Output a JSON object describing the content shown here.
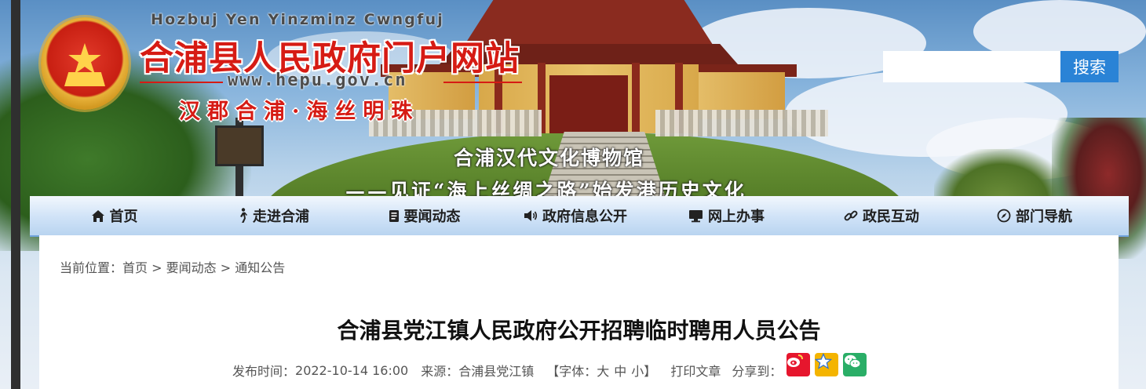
{
  "header": {
    "pinyin": "Hozbuj Yen Yinzminz Cwngfuj",
    "site_title": "合浦县人民政府门户网站",
    "site_url": "www.hepu.gov.cn",
    "slogan": "汉郡合浦·海丝明珠",
    "banner_caption": "合浦汉代文化博物馆",
    "banner_subcaption": "——见证“海上丝绸之路”始发港历史文化"
  },
  "search": {
    "placeholder": "",
    "button_label": "搜索",
    "accent_color": "#2a83d6"
  },
  "nav": {
    "items": [
      {
        "label": "首页",
        "icon": "home-icon"
      },
      {
        "label": "走进合浦",
        "icon": "walking-person-icon"
      },
      {
        "label": "要闻动态",
        "icon": "document-icon"
      },
      {
        "label": "政府信息公开",
        "icon": "speaker-icon"
      },
      {
        "label": "网上办事",
        "icon": "monitor-icon"
      },
      {
        "label": "政民互动",
        "icon": "link-icon"
      },
      {
        "label": "部门导航",
        "icon": "compass-icon"
      }
    ]
  },
  "breadcrumb": {
    "prefix": "当前位置：",
    "items": [
      "首页",
      "要闻动态",
      "通知公告"
    ],
    "separator": " > "
  },
  "article": {
    "title": "合浦县党江镇人民政府公开招聘临时聘用人员公告",
    "publish_label": "发布时间：",
    "publish_time": "2022-10-14 16:00",
    "source_label": "来源：",
    "source": "合浦县党江镇",
    "font_open": "【字体：",
    "font_large": "大",
    "font_medium": "中",
    "font_small": "小",
    "font_close": "】",
    "print_label": "打印文章",
    "share_label": "分享到：",
    "share_targets": [
      {
        "name": "weibo-icon",
        "color": "#e6162d"
      },
      {
        "name": "qzone-icon",
        "color": "#f4b400"
      },
      {
        "name": "wechat-icon",
        "color": "#2aae67"
      }
    ]
  }
}
